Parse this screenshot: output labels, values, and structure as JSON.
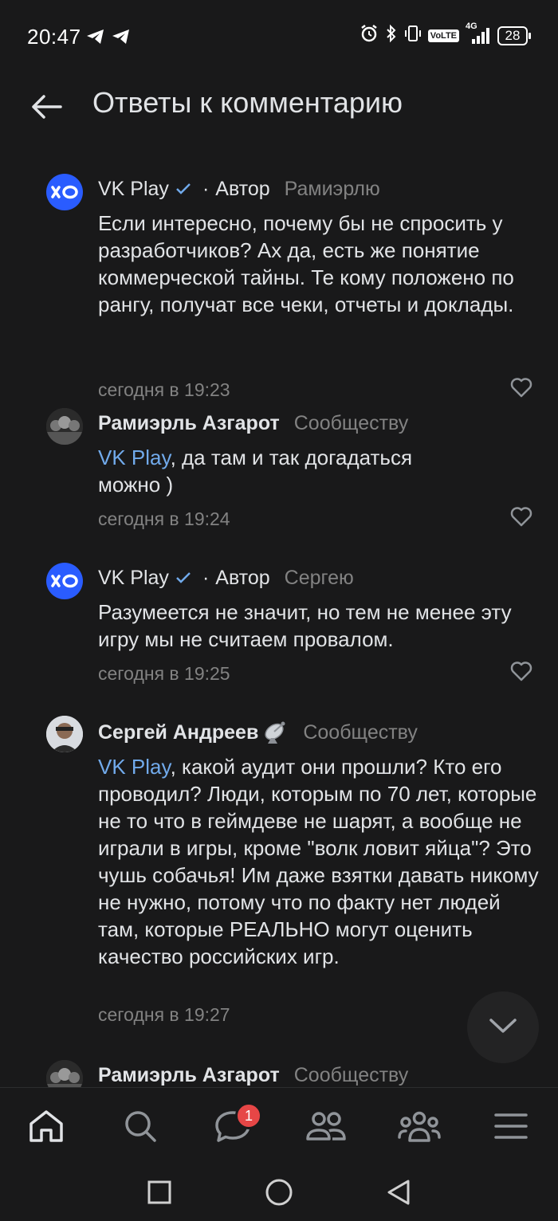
{
  "status_bar": {
    "time": "20:47",
    "battery": "28",
    "network": "4G",
    "volte": "VoLTE",
    "icons": [
      "telegram-icon",
      "telegram-icon",
      "alarm-icon",
      "bluetooth-icon",
      "vibrate-icon",
      "volte-icon",
      "signal-icon",
      "battery-icon"
    ]
  },
  "header": {
    "title": "Ответы к комментарию",
    "back_icon": "arrow-left-icon"
  },
  "comments": [
    {
      "author": "VK Play",
      "verified": true,
      "role": "Автор",
      "reply_to": "Рамиэрлю",
      "mention": "",
      "text": "Если интересно, почему бы не спросить у разработчиков? Ах да, есть же понятие коммерческой тайны. Те кому положено по рангу, получат все чеки, отчеты и доклады.",
      "time": "сегодня в 19:23"
    },
    {
      "author": "Рамиэрль Азгарот",
      "reply_to": "Сообществу",
      "mention": "VK Play",
      "text": ",  да там и так догадаться можно )",
      "time": "сегодня в 19:24"
    },
    {
      "author": "VK Play",
      "verified": true,
      "role": "Автор",
      "reply_to": "Сергею",
      "mention": "",
      "text": "Разумеется не значит, но тем не менее эту игру мы не считаем провалом.",
      "time": "сегодня в 19:25"
    },
    {
      "author": "Сергей Андреев",
      "author_badge": "satellite-dish-icon",
      "reply_to": "Сообществу",
      "mention": "VK Play",
      "text": ", какой аудит они прошли? Кто его проводил? Люди, которым по 70 лет, которые не то что в геймдеве не шарят, а вообще не играли в игры, кроме \"волк ловит яйца\"? Это чушь собачья! Им даже взятки давать никому не нужно, потому что по факту нет людей там, которые РЕАЛЬНО могут оценить качество российских игр.",
      "time": "сегодня в 19:27"
    },
    {
      "author": "Рамиэрль Азгарот",
      "reply_to": "Сообществу"
    }
  ],
  "tab_bar": {
    "tabs": [
      "home-icon",
      "search-icon",
      "messages-icon",
      "friends-icon",
      "communities-icon",
      "menu-icon"
    ],
    "messages_badge": "1"
  },
  "nav_bar": [
    "recent-apps-icon",
    "home-circle-icon",
    "back-triangle-icon"
  ],
  "colors": {
    "background": "#19191a",
    "text": "#e1e3e6",
    "secondary": "#828282",
    "link": "#71aaeb",
    "vk_blue": "#2a5cff",
    "badge": "#e64646"
  }
}
